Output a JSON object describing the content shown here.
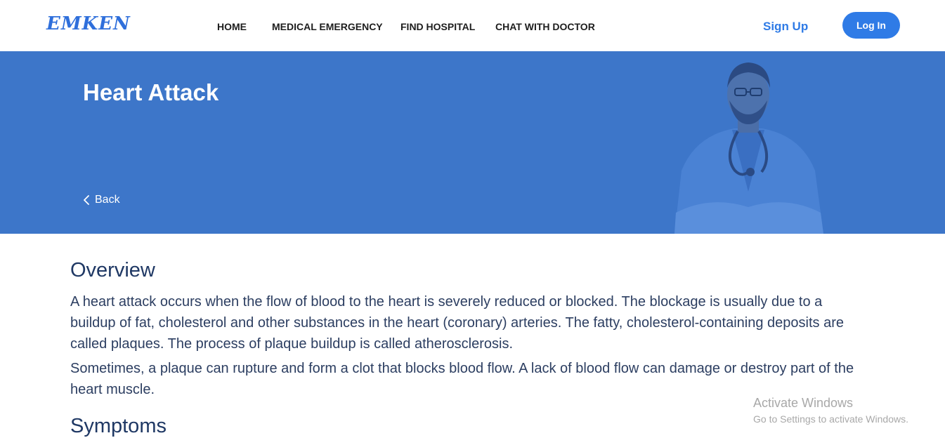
{
  "navbar": {
    "logo": "EMKEN",
    "links": [
      {
        "label": "HOME"
      },
      {
        "label": "MEDICAL EMERGENCY"
      },
      {
        "label": "FIND HOSPITAL"
      },
      {
        "label": "CHAT WITH DOCTOR"
      }
    ],
    "signup_label": "Sign Up",
    "login_label": "Log In"
  },
  "hero": {
    "title": "Heart Attack",
    "back_label": "Back",
    "back_icon": "chevron-left-icon",
    "background_color": "#3d76c9"
  },
  "content": {
    "overview_title": "Overview",
    "overview_paragraphs": [
      "A heart attack occurs when the flow of blood to the heart is severely reduced or blocked. The blockage is usually due to a buildup of fat, cholesterol and other substances in the heart (coronary) arteries. The fatty, cholesterol-containing deposits are called plaques. The process of plaque buildup is called atherosclerosis.",
      "Sometimes, a plaque can rupture and form a clot that blocks blood flow. A lack of blood flow can damage or destroy part of the heart muscle."
    ],
    "symptoms_title": "Symptoms"
  },
  "watermark": {
    "title": "Activate Windows",
    "subtitle": "Go to Settings to activate Windows."
  },
  "colors": {
    "accent": "#2f7be6",
    "heading": "#1f3864",
    "text": "#2c3e61"
  }
}
